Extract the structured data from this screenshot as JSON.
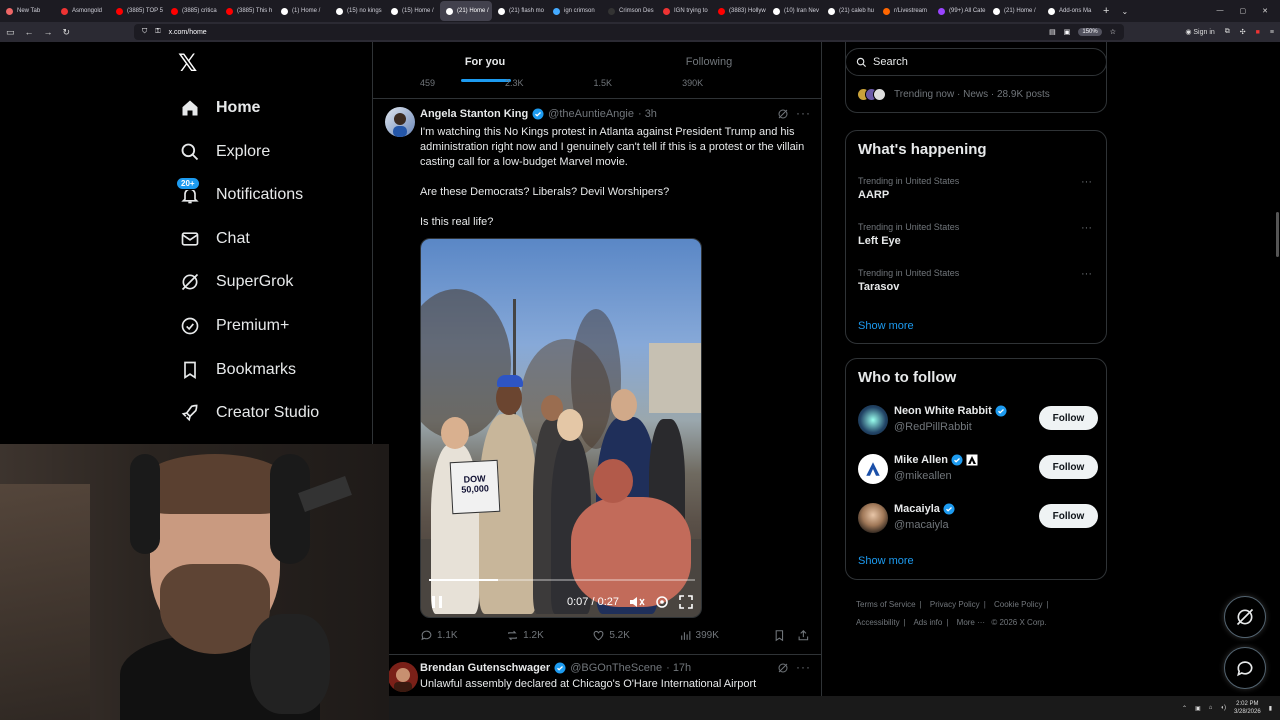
{
  "browser": {
    "tabs": [
      {
        "title": "New Tab",
        "color": "#e66"
      },
      {
        "title": "Asmongold",
        "color": "#e33"
      },
      {
        "title": "(3885) TOP 5",
        "color": "#f00"
      },
      {
        "title": "(3885) critica",
        "color": "#f00"
      },
      {
        "title": "(3885) This h",
        "color": "#f00"
      },
      {
        "title": "(1) Home / ",
        "color": "#fff"
      },
      {
        "title": "(15) no kings",
        "color": "#fff"
      },
      {
        "title": "(15) Home / ",
        "color": "#fff"
      },
      {
        "title": "(21) Home /",
        "color": "#fff",
        "active": true
      },
      {
        "title": "(21) flash mo",
        "color": "#fff"
      },
      {
        "title": "ign crimson",
        "color": "#4af"
      },
      {
        "title": "Crimson Des",
        "color": "#333"
      },
      {
        "title": "IGN trying to",
        "color": "#e33"
      },
      {
        "title": "(3883) Hollyw",
        "color": "#f00"
      },
      {
        "title": "(10) Iran Nev",
        "color": "#fff"
      },
      {
        "title": "(21) caleb hu",
        "color": "#fff"
      },
      {
        "title": "r/Livestream",
        "color": "#f60"
      },
      {
        "title": "(99+) All Cate",
        "color": "#94f"
      },
      {
        "title": "(21) Home /",
        "color": "#fff"
      },
      {
        "title": "Add-ons Ma",
        "color": "#fff"
      }
    ],
    "url": "x.com/home",
    "zoom": "150%",
    "sign_in": "Sign in"
  },
  "nav": {
    "items": [
      {
        "label": "Home",
        "icon": "home-icon"
      },
      {
        "label": "Explore",
        "icon": "search-icon"
      },
      {
        "label": "Notifications",
        "icon": "bell-icon",
        "badge": "20+"
      },
      {
        "label": "Chat",
        "icon": "mail-icon"
      },
      {
        "label": "SuperGrok",
        "icon": "grok-icon"
      },
      {
        "label": "Premium+",
        "icon": "verified-icon"
      },
      {
        "label": "Bookmarks",
        "icon": "bookmark-icon"
      },
      {
        "label": "Creator Studio",
        "icon": "rocket-icon"
      }
    ]
  },
  "feed": {
    "tabs": [
      "For you",
      "Following"
    ],
    "prev_actions": [
      "459",
      "2.3K",
      "1.5K",
      "390K"
    ],
    "tweet1": {
      "name": "Angela Stanton King",
      "handle": "@theAuntieAngie",
      "time": "· 3h",
      "text": [
        "I'm watching this No Kings protest in Atlanta against President Trump and his administration right now and I genuinely can't tell if this is a protest or the villain casting call for a low-budget Marvel movie.",
        "Are these Democrats? Liberals? Devil Worshipers?",
        "Is this real life?"
      ],
      "video": {
        "sign_text": "DOW 50,000",
        "time": "0:07 / 0:27",
        "progress": 0.26
      },
      "replies": "1.1K",
      "reposts": "1.2K",
      "likes": "5.2K",
      "views": "399K"
    },
    "tweet2": {
      "name": "Brendan Gutenschwager",
      "handle": "@BGOnTheScene",
      "time": "· 17h",
      "text": "Unlawful assembly declared at Chicago's O'Hare International Airport"
    }
  },
  "sidebar": {
    "search_placeholder": "Search",
    "trending_now": "Trending now · News · 28.9K posts",
    "happening": {
      "title": "What's happening",
      "trends": [
        {
          "context": "Trending in United States",
          "topic": "AARP"
        },
        {
          "context": "Trending in United States",
          "topic": "Left Eye"
        },
        {
          "context": "Trending in United States",
          "topic": "Tarasov"
        }
      ],
      "show_more": "Show more"
    },
    "who_to_follow": {
      "title": "Who to follow",
      "accounts": [
        {
          "name": "Neon White Rabbit",
          "handle": "@RedPillRabbit",
          "button": "Follow"
        },
        {
          "name": "Mike Allen",
          "handle": "@mikeallen",
          "button": "Follow"
        },
        {
          "name": "Macaiyla",
          "handle": "@macaiyla",
          "button": "Follow"
        }
      ],
      "show_more": "Show more"
    },
    "footer": [
      "Terms of Service",
      "Privacy Policy",
      "Cookie Policy",
      "Accessibility",
      "Ads info",
      "More ···",
      "© 2026 X Corp."
    ]
  },
  "taskbar": {
    "time": "2:02 PM",
    "date": "3/28/2026"
  },
  "colors": {
    "accent": "#1d9bf0",
    "background": "#000000",
    "border": "#2f3336",
    "secondary_text": "#71767b"
  }
}
